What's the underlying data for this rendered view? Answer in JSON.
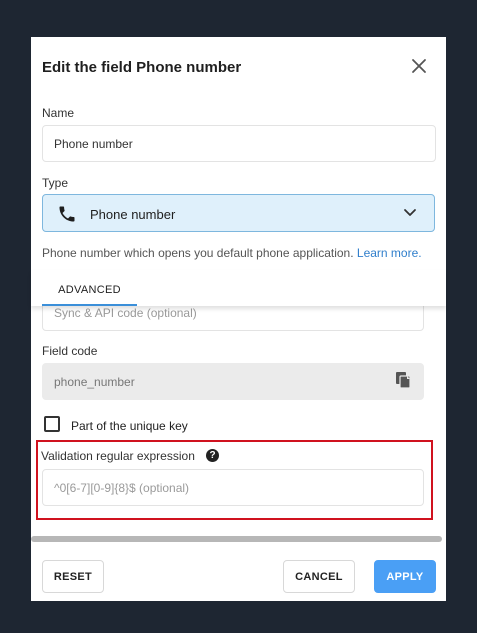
{
  "dialog": {
    "title": "Edit the field Phone number"
  },
  "name_field": {
    "label": "Name",
    "value": "Phone number"
  },
  "type_field": {
    "label": "Type",
    "selected": "Phone number",
    "icon": "phone-icon",
    "help": "Phone number which opens you default phone application.",
    "learn_more": "Learn more."
  },
  "tabs": [
    {
      "label": "ADVANCED",
      "active": true
    }
  ],
  "sync_code": {
    "placeholder": "Sync & API code (optional)"
  },
  "field_code": {
    "label": "Field code",
    "value": "phone_number",
    "icon": "copy-icon"
  },
  "unique_key": {
    "label": "Part of the unique key",
    "checked": false
  },
  "validation": {
    "label": "Validation regular expression",
    "help_icon": "?",
    "placeholder": "^0[6-7][0-9]{8}$ (optional)"
  },
  "footer": {
    "reset": "RESET",
    "cancel": "CANCEL",
    "apply": "APPLY"
  },
  "colors": {
    "accent": "#4a9ff5",
    "selected_bg": "#dff0fb",
    "highlight": "#d0121f",
    "link": "#2f7ecb"
  }
}
